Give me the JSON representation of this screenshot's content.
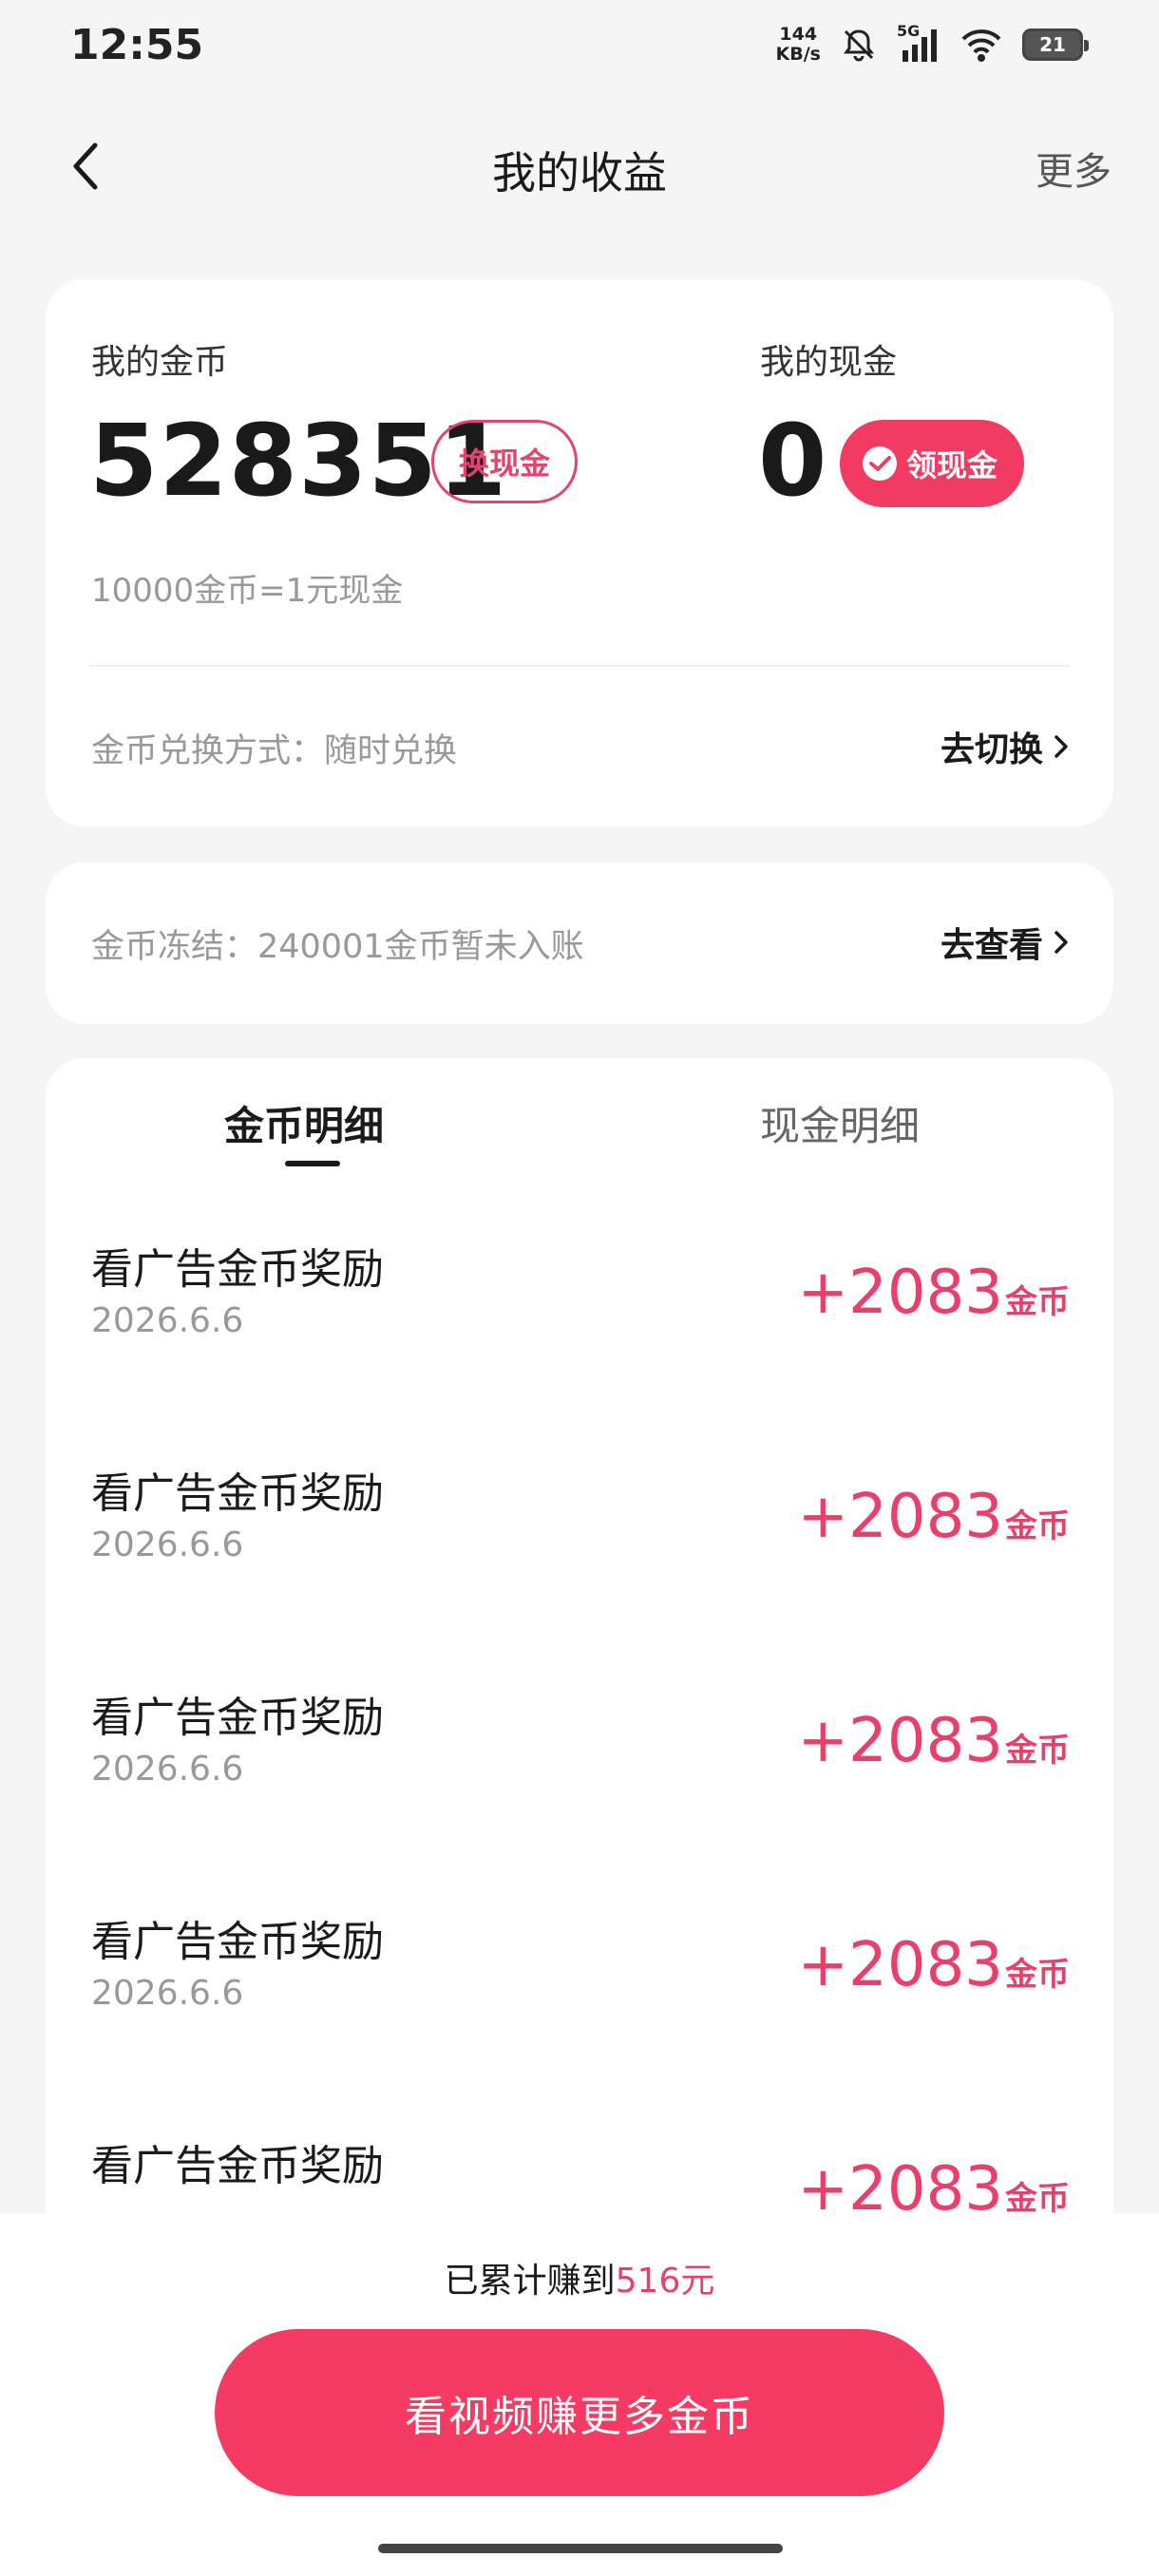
{
  "status_bar": {
    "time": "12:55",
    "net_speed_value": "144",
    "net_speed_unit": "KB/s",
    "network_type": "5G",
    "battery_level": "21"
  },
  "header": {
    "title": "我的收益",
    "more_label": "更多"
  },
  "balance_card": {
    "coins_label": "我的金币",
    "coins_value": "528351",
    "exchange_button": "换现金",
    "cash_label": "我的现金",
    "cash_value": "0",
    "withdraw_button": "领现金",
    "rate_text": "10000金币=1元现金",
    "exchange_mode_text": "金币兑换方式：随时兑换",
    "switch_link": "去切换"
  },
  "frozen_card": {
    "text": "金币冻结：240001金币暂未入账",
    "link": "去查看"
  },
  "details": {
    "tabs": [
      "金币明细",
      "现金明细"
    ],
    "records": [
      {
        "title": "看广告金币奖励",
        "date": "2026.6.6",
        "amount": "+2083",
        "unit": "金币"
      },
      {
        "title": "看广告金币奖励",
        "date": "2026.6.6",
        "amount": "+2083",
        "unit": "金币"
      },
      {
        "title": "看广告金币奖励",
        "date": "2026.6.6",
        "amount": "+2083",
        "unit": "金币"
      },
      {
        "title": "看广告金币奖励",
        "date": "2026.6.6",
        "amount": "+2083",
        "unit": "金币"
      },
      {
        "title": "看广告金币奖励",
        "date": "",
        "amount": "+2083",
        "unit": "金币"
      }
    ]
  },
  "footer": {
    "earned_prefix": "已累计赚到",
    "earned_amount": "516元",
    "cta_label": "看视频赚更多金币"
  },
  "colors": {
    "accent": "#f23b62",
    "accent_text": "#e8406a",
    "background": "#f5f5f5"
  }
}
